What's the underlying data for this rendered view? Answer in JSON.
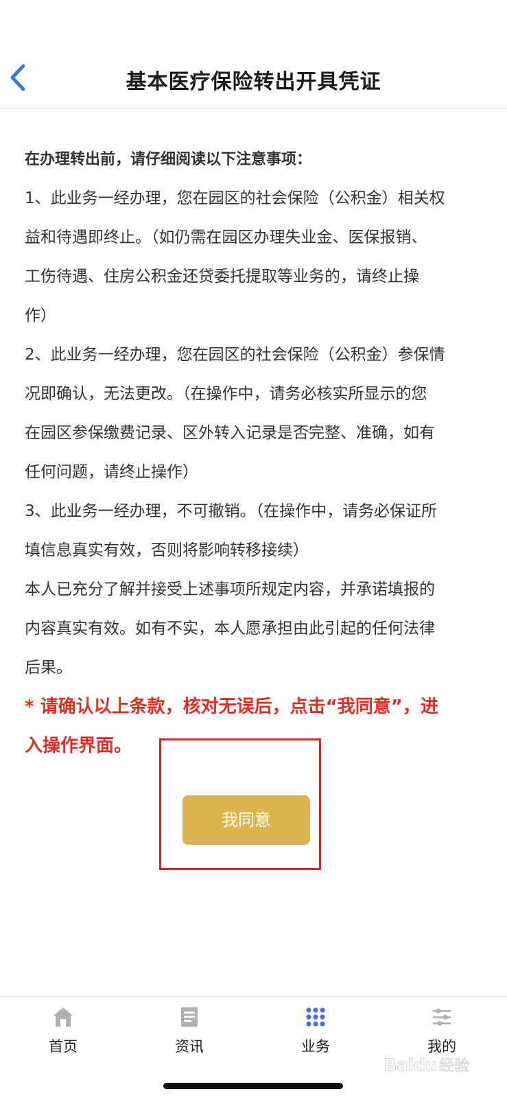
{
  "header": {
    "title": "基本医疗保险转出开具凭证",
    "back_icon": "chevron-left-icon"
  },
  "content": {
    "intro": "在办理转出前，请仔细阅读以下注意事项：",
    "clauses": [
      {
        "lines": [
          "1、此业务一经办理，您在园区的社会保险（公积金）相关权",
          "益和待遇即终止。（如仍需在园区办理失业金、医保报销、",
          "工伤待遇、住房公积金还贷委托提取等业务的，请终止操",
          "作）"
        ]
      },
      {
        "lines": [
          "2、此业务一经办理，您在园区的社会保险（公积金）参保情",
          "况即确认，无法更改。（在操作中，请务必核实所显示的您",
          "在园区参保缴费记录、区外转入记录是否完整、准确，如有",
          "任何问题，请终止操作）"
        ]
      },
      {
        "lines": [
          "3、此业务一经办理，不可撤销。（在操作中，请务必保证所",
          "填信息真实有效，否则将影响转移接续）"
        ]
      }
    ],
    "declaration_lines": [
      "本人已充分了解并接受上述事项所规定内容，并承诺填报的",
      "内容真实有效。如有不实，本人愿承担由此引起的任何法律",
      "后果。"
    ],
    "warning_lines": [
      "* 请确认以上条款，核对无误后，点击“我同意”，进",
      "入操作界面。"
    ],
    "warning_color": "#e02e24"
  },
  "agree_button": {
    "label": "我同意",
    "color": "#dcb550"
  },
  "tab_bar": {
    "items": [
      {
        "label": "首页",
        "icon": "home-icon"
      },
      {
        "label": "资讯",
        "icon": "news-icon"
      },
      {
        "label": "业务",
        "icon": "grid-icon",
        "active": true
      },
      {
        "label": "我的",
        "icon": "sliders-icon"
      }
    ],
    "active_color": "#4a6fd6",
    "inactive_color": "#aaaaaa"
  },
  "watermark": "Baidu 经验"
}
